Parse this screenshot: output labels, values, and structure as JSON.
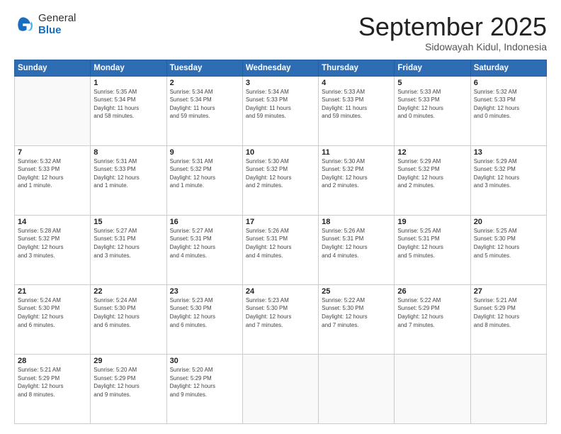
{
  "logo": {
    "general": "General",
    "blue": "Blue"
  },
  "header": {
    "month": "September 2025",
    "location": "Sidowayah Kidul, Indonesia"
  },
  "weekdays": [
    "Sunday",
    "Monday",
    "Tuesday",
    "Wednesday",
    "Thursday",
    "Friday",
    "Saturday"
  ],
  "weeks": [
    [
      {
        "day": "",
        "info": ""
      },
      {
        "day": "1",
        "info": "Sunrise: 5:35 AM\nSunset: 5:34 PM\nDaylight: 11 hours\nand 58 minutes."
      },
      {
        "day": "2",
        "info": "Sunrise: 5:34 AM\nSunset: 5:34 PM\nDaylight: 11 hours\nand 59 minutes."
      },
      {
        "day": "3",
        "info": "Sunrise: 5:34 AM\nSunset: 5:33 PM\nDaylight: 11 hours\nand 59 minutes."
      },
      {
        "day": "4",
        "info": "Sunrise: 5:33 AM\nSunset: 5:33 PM\nDaylight: 11 hours\nand 59 minutes."
      },
      {
        "day": "5",
        "info": "Sunrise: 5:33 AM\nSunset: 5:33 PM\nDaylight: 12 hours\nand 0 minutes."
      },
      {
        "day": "6",
        "info": "Sunrise: 5:32 AM\nSunset: 5:33 PM\nDaylight: 12 hours\nand 0 minutes."
      }
    ],
    [
      {
        "day": "7",
        "info": "Sunrise: 5:32 AM\nSunset: 5:33 PM\nDaylight: 12 hours\nand 1 minute."
      },
      {
        "day": "8",
        "info": "Sunrise: 5:31 AM\nSunset: 5:33 PM\nDaylight: 12 hours\nand 1 minute."
      },
      {
        "day": "9",
        "info": "Sunrise: 5:31 AM\nSunset: 5:32 PM\nDaylight: 12 hours\nand 1 minute."
      },
      {
        "day": "10",
        "info": "Sunrise: 5:30 AM\nSunset: 5:32 PM\nDaylight: 12 hours\nand 2 minutes."
      },
      {
        "day": "11",
        "info": "Sunrise: 5:30 AM\nSunset: 5:32 PM\nDaylight: 12 hours\nand 2 minutes."
      },
      {
        "day": "12",
        "info": "Sunrise: 5:29 AM\nSunset: 5:32 PM\nDaylight: 12 hours\nand 2 minutes."
      },
      {
        "day": "13",
        "info": "Sunrise: 5:29 AM\nSunset: 5:32 PM\nDaylight: 12 hours\nand 3 minutes."
      }
    ],
    [
      {
        "day": "14",
        "info": "Sunrise: 5:28 AM\nSunset: 5:32 PM\nDaylight: 12 hours\nand 3 minutes."
      },
      {
        "day": "15",
        "info": "Sunrise: 5:27 AM\nSunset: 5:31 PM\nDaylight: 12 hours\nand 3 minutes."
      },
      {
        "day": "16",
        "info": "Sunrise: 5:27 AM\nSunset: 5:31 PM\nDaylight: 12 hours\nand 4 minutes."
      },
      {
        "day": "17",
        "info": "Sunrise: 5:26 AM\nSunset: 5:31 PM\nDaylight: 12 hours\nand 4 minutes."
      },
      {
        "day": "18",
        "info": "Sunrise: 5:26 AM\nSunset: 5:31 PM\nDaylight: 12 hours\nand 4 minutes."
      },
      {
        "day": "19",
        "info": "Sunrise: 5:25 AM\nSunset: 5:31 PM\nDaylight: 12 hours\nand 5 minutes."
      },
      {
        "day": "20",
        "info": "Sunrise: 5:25 AM\nSunset: 5:30 PM\nDaylight: 12 hours\nand 5 minutes."
      }
    ],
    [
      {
        "day": "21",
        "info": "Sunrise: 5:24 AM\nSunset: 5:30 PM\nDaylight: 12 hours\nand 6 minutes."
      },
      {
        "day": "22",
        "info": "Sunrise: 5:24 AM\nSunset: 5:30 PM\nDaylight: 12 hours\nand 6 minutes."
      },
      {
        "day": "23",
        "info": "Sunrise: 5:23 AM\nSunset: 5:30 PM\nDaylight: 12 hours\nand 6 minutes."
      },
      {
        "day": "24",
        "info": "Sunrise: 5:23 AM\nSunset: 5:30 PM\nDaylight: 12 hours\nand 7 minutes."
      },
      {
        "day": "25",
        "info": "Sunrise: 5:22 AM\nSunset: 5:30 PM\nDaylight: 12 hours\nand 7 minutes."
      },
      {
        "day": "26",
        "info": "Sunrise: 5:22 AM\nSunset: 5:29 PM\nDaylight: 12 hours\nand 7 minutes."
      },
      {
        "day": "27",
        "info": "Sunrise: 5:21 AM\nSunset: 5:29 PM\nDaylight: 12 hours\nand 8 minutes."
      }
    ],
    [
      {
        "day": "28",
        "info": "Sunrise: 5:21 AM\nSunset: 5:29 PM\nDaylight: 12 hours\nand 8 minutes."
      },
      {
        "day": "29",
        "info": "Sunrise: 5:20 AM\nSunset: 5:29 PM\nDaylight: 12 hours\nand 9 minutes."
      },
      {
        "day": "30",
        "info": "Sunrise: 5:20 AM\nSunset: 5:29 PM\nDaylight: 12 hours\nand 9 minutes."
      },
      {
        "day": "",
        "info": ""
      },
      {
        "day": "",
        "info": ""
      },
      {
        "day": "",
        "info": ""
      },
      {
        "day": "",
        "info": ""
      }
    ]
  ]
}
